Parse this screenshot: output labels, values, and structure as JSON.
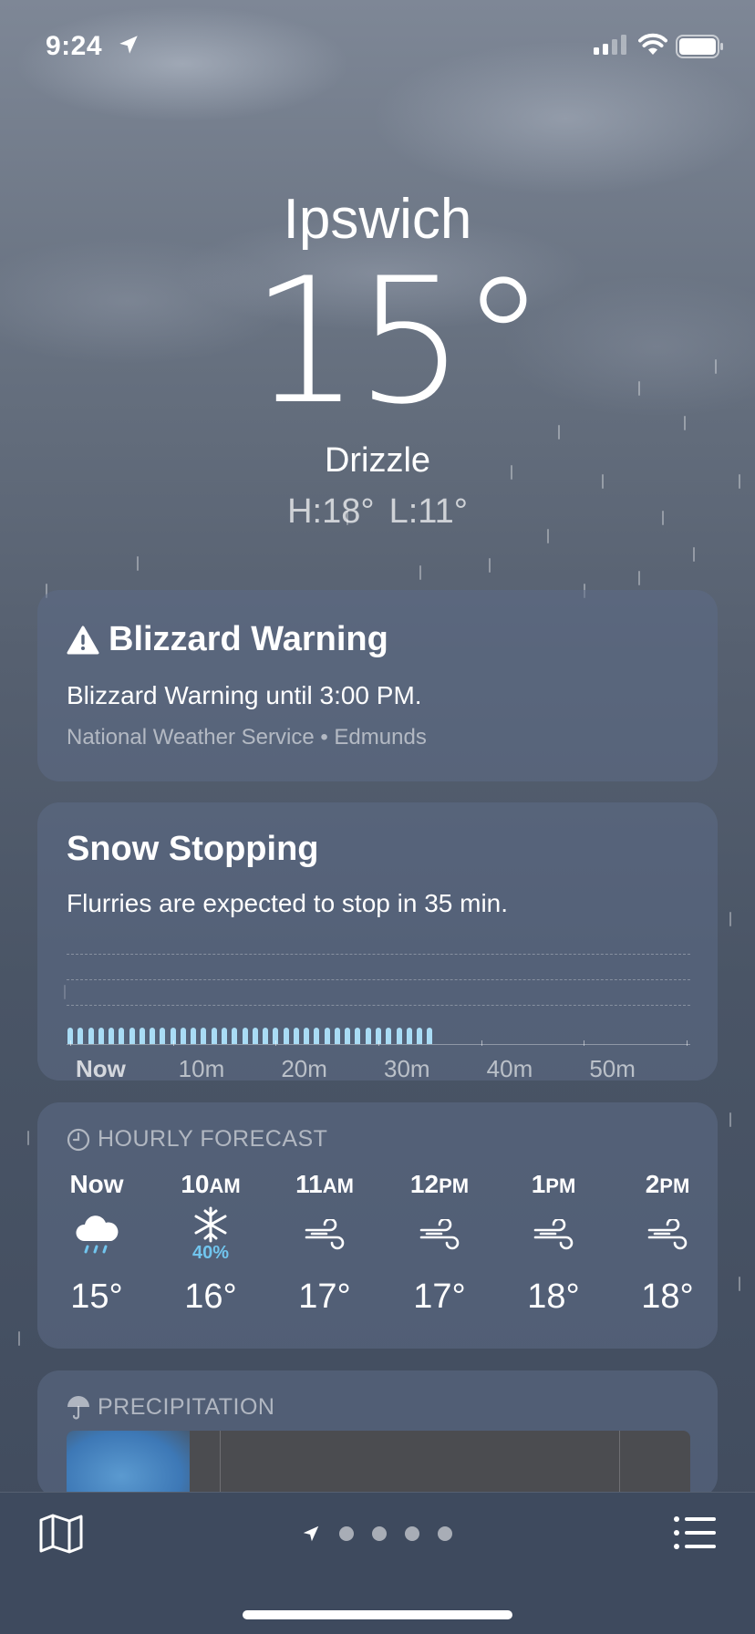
{
  "status_bar": {
    "time": "9:24"
  },
  "header": {
    "city": "Ipswich",
    "temperature": "15°",
    "condition": "Drizzle",
    "high": "H:18°",
    "low": "L:11°"
  },
  "alert": {
    "title": "Blizzard Warning",
    "description": "Blizzard Warning until 3:00 PM.",
    "source": "National Weather Service • Edmunds"
  },
  "snow": {
    "title": "Snow Stopping",
    "description": "Flurries are expected to stop in 35 min.",
    "axis_labels": [
      "Now",
      "10m",
      "20m",
      "30m",
      "40m",
      "50m"
    ]
  },
  "chart_data": {
    "type": "bar",
    "x_unit": "minutes from now",
    "x": [
      0,
      1,
      2,
      3,
      4,
      5,
      6,
      7,
      8,
      9,
      10,
      11,
      12,
      13,
      14,
      15,
      16,
      17,
      18,
      19,
      20,
      21,
      22,
      23,
      24,
      25,
      26,
      27,
      28,
      29,
      30,
      31,
      32,
      33,
      34,
      35
    ],
    "values": [
      1,
      1,
      1,
      1,
      1,
      1,
      1,
      1,
      1,
      1,
      1,
      1,
      1,
      1,
      1,
      1,
      1,
      1,
      1,
      1,
      1,
      1,
      1,
      1,
      1,
      1,
      1,
      1,
      1,
      1,
      1,
      1,
      1,
      1,
      1,
      1
    ],
    "xlim": [
      0,
      60
    ],
    "xticks": [
      "Now",
      "10m",
      "20m",
      "30m",
      "40m",
      "50m"
    ],
    "grid": true
  },
  "hourly": {
    "header": "HOURLY FORECAST",
    "items": [
      {
        "label": "Now",
        "suffix": "",
        "icon": "cloud-rain-icon",
        "pct": "",
        "temp": "15°"
      },
      {
        "label": "10",
        "suffix": "AM",
        "icon": "snowflake-icon",
        "pct": "40%",
        "temp": "16°"
      },
      {
        "label": "11",
        "suffix": "AM",
        "icon": "wind-icon",
        "pct": "",
        "temp": "17°"
      },
      {
        "label": "12",
        "suffix": "PM",
        "icon": "wind-icon",
        "pct": "",
        "temp": "17°"
      },
      {
        "label": "1",
        "suffix": "PM",
        "icon": "wind-icon",
        "pct": "",
        "temp": "18°"
      },
      {
        "label": "2",
        "suffix": "PM",
        "icon": "wind-icon",
        "pct": "",
        "temp": "18°"
      }
    ]
  },
  "precipitation": {
    "header": "PRECIPITATION"
  },
  "colors": {
    "rain_bar": "#a9dcf5",
    "pct_text": "#71c5ee"
  }
}
